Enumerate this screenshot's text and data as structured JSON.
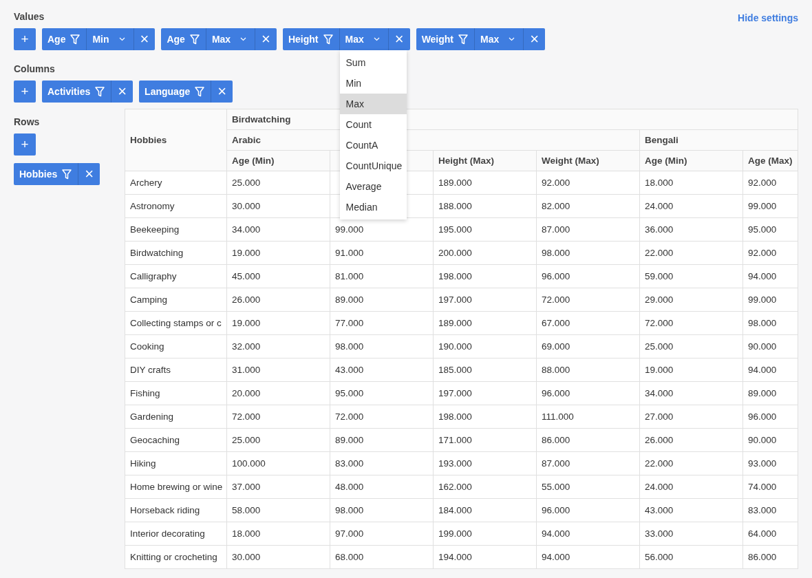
{
  "hide_settings_link": "Hide settings",
  "values": {
    "label": "Values",
    "add": "+",
    "chips": [
      {
        "field": "Age",
        "aggregation": "Min",
        "close": "×"
      },
      {
        "field": "Age",
        "aggregation": "Max",
        "close": "×"
      },
      {
        "field": "Height",
        "aggregation": "Max",
        "close": "×",
        "menu": [
          {
            "label": "Sum",
            "selected": false
          },
          {
            "label": "Min",
            "selected": false
          },
          {
            "label": "Max",
            "selected": true
          },
          {
            "label": "Count",
            "selected": false
          },
          {
            "label": "CountA",
            "selected": false
          },
          {
            "label": "CountUnique",
            "selected": false
          },
          {
            "label": "Average",
            "selected": false
          },
          {
            "label": "Median",
            "selected": false
          }
        ]
      },
      {
        "field": "Weight",
        "aggregation": "Max",
        "close": "×"
      }
    ]
  },
  "columns": {
    "label": "Columns",
    "add": "+",
    "chips": [
      {
        "field": "Activities",
        "close": "×"
      },
      {
        "field": "Language",
        "close": "×"
      }
    ]
  },
  "rows": {
    "label": "Rows",
    "add": "+",
    "chips": [
      {
        "field": "Hobbies",
        "close": "×"
      }
    ]
  },
  "table": {
    "row_header": "Hobbies",
    "groups": [
      {
        "label": "Birdwatching",
        "children": [
          {
            "label": "Arabic",
            "columns": [
              "Age (Min)",
              null,
              "Height (Max)",
              "Weight (Max)"
            ]
          },
          {
            "label": "Bengali",
            "columns": [
              "Age (Min)",
              "Age (Max)"
            ]
          }
        ]
      }
    ],
    "rows": [
      {
        "label": "Archery",
        "cells": [
          "25.000",
          null,
          "189.000",
          "92.000",
          "18.000",
          "92.000"
        ]
      },
      {
        "label": "Astronomy",
        "cells": [
          "30.000",
          null,
          "188.000",
          "82.000",
          "24.000",
          "99.000"
        ]
      },
      {
        "label": "Beekeeping",
        "cells": [
          "34.000",
          "99.000",
          "195.000",
          "87.000",
          "36.000",
          "95.000"
        ]
      },
      {
        "label": "Birdwatching",
        "cells": [
          "19.000",
          "91.000",
          "200.000",
          "98.000",
          "22.000",
          "92.000"
        ]
      },
      {
        "label": "Calligraphy",
        "cells": [
          "45.000",
          "81.000",
          "198.000",
          "96.000",
          "59.000",
          "94.000"
        ]
      },
      {
        "label": "Camping",
        "cells": [
          "26.000",
          "89.000",
          "197.000",
          "72.000",
          "29.000",
          "99.000"
        ]
      },
      {
        "label": "Collecting stamps or c",
        "cells": [
          "19.000",
          "77.000",
          "189.000",
          "67.000",
          "72.000",
          "98.000"
        ]
      },
      {
        "label": "Cooking",
        "cells": [
          "32.000",
          "98.000",
          "190.000",
          "69.000",
          "25.000",
          "90.000"
        ]
      },
      {
        "label": "DIY crafts",
        "cells": [
          "31.000",
          "43.000",
          "185.000",
          "88.000",
          "19.000",
          "94.000"
        ]
      },
      {
        "label": "Fishing",
        "cells": [
          "20.000",
          "95.000",
          "197.000",
          "96.000",
          "34.000",
          "89.000"
        ]
      },
      {
        "label": "Gardening",
        "cells": [
          "72.000",
          "72.000",
          "198.000",
          "111.000",
          "27.000",
          "96.000"
        ]
      },
      {
        "label": "Geocaching",
        "cells": [
          "25.000",
          "89.000",
          "171.000",
          "86.000",
          "26.000",
          "90.000"
        ]
      },
      {
        "label": "Hiking",
        "cells": [
          "100.000",
          "83.000",
          "193.000",
          "87.000",
          "22.000",
          "93.000"
        ]
      },
      {
        "label": "Home brewing or wine",
        "cells": [
          "37.000",
          "48.000",
          "162.000",
          "55.000",
          "24.000",
          "74.000"
        ]
      },
      {
        "label": "Horseback riding",
        "cells": [
          "58.000",
          "98.000",
          "184.000",
          "96.000",
          "43.000",
          "83.000"
        ]
      },
      {
        "label": "Interior decorating",
        "cells": [
          "18.000",
          "97.000",
          "199.000",
          "94.000",
          "33.000",
          "64.000"
        ]
      },
      {
        "label": "Knitting or crocheting",
        "cells": [
          "30.000",
          "68.000",
          "194.000",
          "94.000",
          "56.000",
          "86.000"
        ]
      }
    ]
  }
}
